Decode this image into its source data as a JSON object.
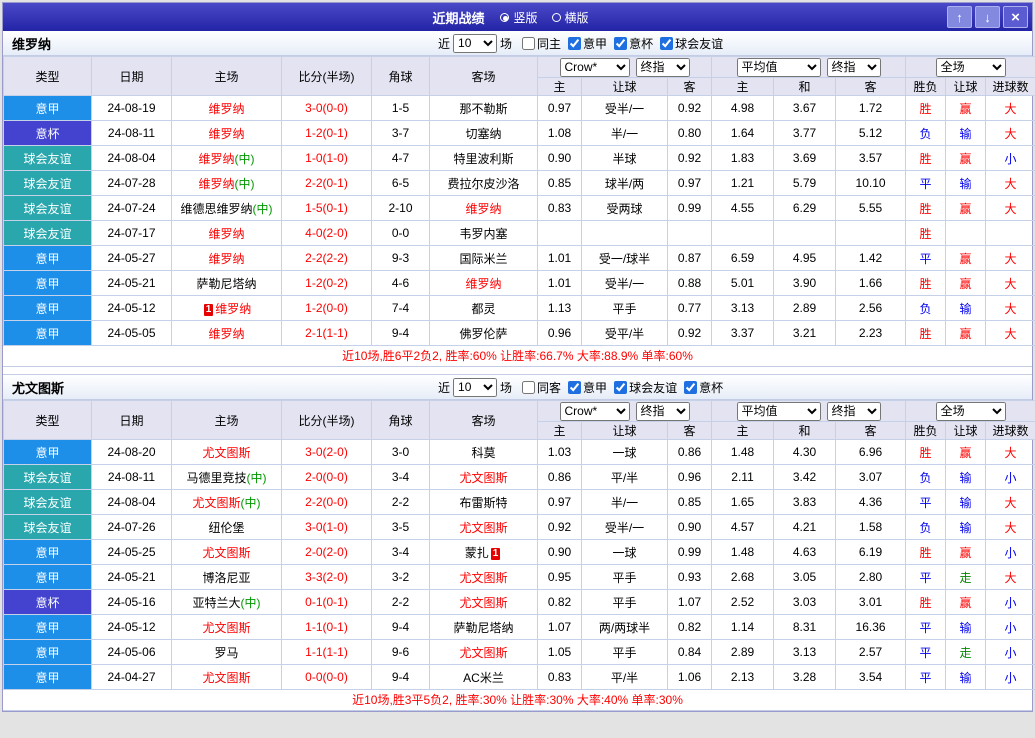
{
  "titlebar": {
    "title": "近期战绩",
    "layout_options": [
      {
        "label": "竖版",
        "selected": true
      },
      {
        "label": "横版",
        "selected": false
      }
    ],
    "up_button": "↑",
    "down_button": "↓",
    "close_button": "×"
  },
  "filter_labels": {
    "near": "近",
    "games": "场"
  },
  "table_header": {
    "left_columns": [
      "类型",
      "日期",
      "主场",
      "比分(半场)",
      "角球",
      "客场"
    ],
    "odds_subcolumns": [
      "主",
      "让球",
      "客"
    ],
    "avg_subcolumns": [
      "主",
      "和",
      "客"
    ],
    "result_subcolumns": [
      "胜负",
      "让球",
      "进球数"
    ],
    "company_select": "Crow*",
    "company_final_select": "终指",
    "avg_select": "平均值",
    "avg_final_select": "终指",
    "scope_select": "全场"
  },
  "league_colors": {
    "意甲": "#1E8FE8",
    "意杯": "#4343CF",
    "球会友谊": "#2AA7AD"
  },
  "result_colors": {
    "胜": "#FF0000",
    "平": "#0000EE",
    "负": "#0000EE",
    "赢": "#FF0000",
    "走": "#008800",
    "输": "#0000EE",
    "大": "#FF0000",
    "小": "#0000EE"
  },
  "sections": [
    {
      "team": "维罗纳",
      "filters": {
        "count": "10",
        "same_side": {
          "label": "同主",
          "checked": false
        },
        "leagues": [
          {
            "label": "意甲",
            "checked": true
          },
          {
            "label": "意杯",
            "checked": true
          },
          {
            "label": "球会友谊",
            "checked": true
          }
        ]
      },
      "rows": [
        {
          "league": "意甲",
          "date": "24-08-19",
          "home": "维罗纳",
          "home_focus": true,
          "home_card": "",
          "score": "3-0(0-0)",
          "corners": "1-5",
          "away": "那不勒斯",
          "away_focus": false,
          "away_card": "",
          "odds": [
            "0.97",
            "受半/一",
            "0.92"
          ],
          "avg": [
            "4.98",
            "3.67",
            "1.72"
          ],
          "results": [
            "胜",
            "赢",
            "大"
          ]
        },
        {
          "league": "意杯",
          "date": "24-08-11",
          "home": "维罗纳",
          "home_focus": true,
          "home_card": "",
          "score": "1-2(0-1)",
          "corners": "3-7",
          "away": "切塞纳",
          "away_focus": false,
          "away_card": "",
          "odds": [
            "1.08",
            "半/一",
            "0.80"
          ],
          "avg": [
            "1.64",
            "3.77",
            "5.12"
          ],
          "results": [
            "负",
            "输",
            "大"
          ]
        },
        {
          "league": "球会友谊",
          "date": "24-08-04",
          "home": "维罗纳(中)",
          "home_focus": true,
          "home_card": "",
          "score": "1-0(1-0)",
          "corners": "4-7",
          "away": "特里波利斯",
          "away_focus": false,
          "away_card": "",
          "odds": [
            "0.90",
            "半球",
            "0.92"
          ],
          "avg": [
            "1.83",
            "3.69",
            "3.57"
          ],
          "results": [
            "胜",
            "赢",
            "小"
          ]
        },
        {
          "league": "球会友谊",
          "date": "24-07-28",
          "home": "维罗纳(中)",
          "home_focus": true,
          "home_card": "",
          "score": "2-2(0-1)",
          "corners": "6-5",
          "away": "费拉尔皮沙洛",
          "away_focus": false,
          "away_card": "",
          "odds": [
            "0.85",
            "球半/两",
            "0.97"
          ],
          "avg": [
            "1.21",
            "5.79",
            "10.10"
          ],
          "results": [
            "平",
            "输",
            "大"
          ]
        },
        {
          "league": "球会友谊",
          "date": "24-07-24",
          "home": "维德思维罗纳(中)",
          "home_focus": false,
          "home_card": "",
          "score": "1-5(0-1)",
          "corners": "2-10",
          "away": "维罗纳",
          "away_focus": true,
          "away_card": "",
          "odds": [
            "0.83",
            "受两球",
            "0.99"
          ],
          "avg": [
            "4.55",
            "6.29",
            "5.55"
          ],
          "results": [
            "胜",
            "赢",
            "大"
          ]
        },
        {
          "league": "球会友谊",
          "date": "24-07-17",
          "home": "维罗纳",
          "home_focus": true,
          "home_card": "",
          "score": "4-0(2-0)",
          "corners": "0-0",
          "away": "韦罗内塞",
          "away_focus": false,
          "away_card": "",
          "odds": [
            "",
            "",
            ""
          ],
          "avg": [
            "",
            "",
            ""
          ],
          "results": [
            "胜",
            "",
            ""
          ]
        },
        {
          "league": "意甲",
          "date": "24-05-27",
          "home": "维罗纳",
          "home_focus": true,
          "home_card": "",
          "score": "2-2(2-2)",
          "corners": "9-3",
          "away": "国际米兰",
          "away_focus": false,
          "away_card": "",
          "odds": [
            "1.01",
            "受一/球半",
            "0.87"
          ],
          "avg": [
            "6.59",
            "4.95",
            "1.42"
          ],
          "results": [
            "平",
            "赢",
            "大"
          ]
        },
        {
          "league": "意甲",
          "date": "24-05-21",
          "home": "萨勒尼塔纳",
          "home_focus": false,
          "home_card": "",
          "score": "1-2(0-2)",
          "corners": "4-6",
          "away": "维罗纳",
          "away_focus": true,
          "away_card": "",
          "odds": [
            "1.01",
            "受半/一",
            "0.88"
          ],
          "avg": [
            "5.01",
            "3.90",
            "1.66"
          ],
          "results": [
            "胜",
            "赢",
            "大"
          ]
        },
        {
          "league": "意甲",
          "date": "24-05-12",
          "home": "维罗纳",
          "home_focus": true,
          "home_card": "1",
          "score": "1-2(0-0)",
          "corners": "7-4",
          "away": "都灵",
          "away_focus": false,
          "away_card": "",
          "odds": [
            "1.13",
            "平手",
            "0.77"
          ],
          "avg": [
            "3.13",
            "2.89",
            "2.56"
          ],
          "results": [
            "负",
            "输",
            "大"
          ]
        },
        {
          "league": "意甲",
          "date": "24-05-05",
          "home": "维罗纳",
          "home_focus": true,
          "home_card": "",
          "score": "2-1(1-1)",
          "corners": "9-4",
          "away": "佛罗伦萨",
          "away_focus": false,
          "away_card": "",
          "odds": [
            "0.96",
            "受平/半",
            "0.92"
          ],
          "avg": [
            "3.37",
            "3.21",
            "2.23"
          ],
          "results": [
            "胜",
            "赢",
            "大"
          ]
        }
      ],
      "summary": "近10场,胜6平2负2, 胜率:60% 让胜率:66.7% 大率:88.9% 单率:60%"
    },
    {
      "team": "尤文图斯",
      "filters": {
        "count": "10",
        "same_side": {
          "label": "同客",
          "checked": false
        },
        "leagues": [
          {
            "label": "意甲",
            "checked": true
          },
          {
            "label": "球会友谊",
            "checked": true
          },
          {
            "label": "意杯",
            "checked": true
          }
        ]
      },
      "rows": [
        {
          "league": "意甲",
          "date": "24-08-20",
          "home": "尤文图斯",
          "home_focus": true,
          "home_card": "",
          "score": "3-0(2-0)",
          "corners": "3-0",
          "away": "科莫",
          "away_focus": false,
          "away_card": "",
          "odds": [
            "1.03",
            "一球",
            "0.86"
          ],
          "avg": [
            "1.48",
            "4.30",
            "6.96"
          ],
          "results": [
            "胜",
            "赢",
            "大"
          ]
        },
        {
          "league": "球会友谊",
          "date": "24-08-11",
          "home": "马德里竞技(中)",
          "home_focus": false,
          "home_card": "",
          "score": "2-0(0-0)",
          "corners": "3-4",
          "away": "尤文图斯",
          "away_focus": true,
          "away_card": "",
          "odds": [
            "0.86",
            "平/半",
            "0.96"
          ],
          "avg": [
            "2.11",
            "3.42",
            "3.07"
          ],
          "results": [
            "负",
            "输",
            "小"
          ]
        },
        {
          "league": "球会友谊",
          "date": "24-08-04",
          "home": "尤文图斯(中)",
          "home_focus": true,
          "home_card": "",
          "score": "2-2(0-0)",
          "corners": "2-2",
          "away": "布雷斯特",
          "away_focus": false,
          "away_card": "",
          "odds": [
            "0.97",
            "半/一",
            "0.85"
          ],
          "avg": [
            "1.65",
            "3.83",
            "4.36"
          ],
          "results": [
            "平",
            "输",
            "大"
          ]
        },
        {
          "league": "球会友谊",
          "date": "24-07-26",
          "home": "纽伦堡",
          "home_focus": false,
          "home_card": "",
          "score": "3-0(1-0)",
          "corners": "3-5",
          "away": "尤文图斯",
          "away_focus": true,
          "away_card": "",
          "odds": [
            "0.92",
            "受半/一",
            "0.90"
          ],
          "avg": [
            "4.57",
            "4.21",
            "1.58"
          ],
          "results": [
            "负",
            "输",
            "大"
          ]
        },
        {
          "league": "意甲",
          "date": "24-05-25",
          "home": "尤文图斯",
          "home_focus": true,
          "home_card": "",
          "score": "2-0(2-0)",
          "corners": "3-4",
          "away": "蒙扎",
          "away_focus": false,
          "away_card": "1",
          "odds": [
            "0.90",
            "一球",
            "0.99"
          ],
          "avg": [
            "1.48",
            "4.63",
            "6.19"
          ],
          "results": [
            "胜",
            "赢",
            "小"
          ]
        },
        {
          "league": "意甲",
          "date": "24-05-21",
          "home": "博洛尼亚",
          "home_focus": false,
          "home_card": "",
          "score": "3-3(2-0)",
          "corners": "3-2",
          "away": "尤文图斯",
          "away_focus": true,
          "away_card": "",
          "odds": [
            "0.95",
            "平手",
            "0.93"
          ],
          "avg": [
            "2.68",
            "3.05",
            "2.80"
          ],
          "results": [
            "平",
            "走",
            "大"
          ]
        },
        {
          "league": "意杯",
          "date": "24-05-16",
          "home": "亚特兰大(中)",
          "home_focus": false,
          "home_card": "",
          "score": "0-1(0-1)",
          "corners": "2-2",
          "away": "尤文图斯",
          "away_focus": true,
          "away_card": "",
          "odds": [
            "0.82",
            "平手",
            "1.07"
          ],
          "avg": [
            "2.52",
            "3.03",
            "3.01"
          ],
          "results": [
            "胜",
            "赢",
            "小"
          ]
        },
        {
          "league": "意甲",
          "date": "24-05-12",
          "home": "尤文图斯",
          "home_focus": true,
          "home_card": "",
          "score": "1-1(0-1)",
          "corners": "9-4",
          "away": "萨勒尼塔纳",
          "away_focus": false,
          "away_card": "",
          "odds": [
            "1.07",
            "两/两球半",
            "0.82"
          ],
          "avg": [
            "1.14",
            "8.31",
            "16.36"
          ],
          "results": [
            "平",
            "输",
            "小"
          ]
        },
        {
          "league": "意甲",
          "date": "24-05-06",
          "home": "罗马",
          "home_focus": false,
          "home_card": "",
          "score": "1-1(1-1)",
          "corners": "9-6",
          "away": "尤文图斯",
          "away_focus": true,
          "away_card": "",
          "odds": [
            "1.05",
            "平手",
            "0.84"
          ],
          "avg": [
            "2.89",
            "3.13",
            "2.57"
          ],
          "results": [
            "平",
            "走",
            "小"
          ]
        },
        {
          "league": "意甲",
          "date": "24-04-27",
          "home": "尤文图斯",
          "home_focus": true,
          "home_card": "",
          "score": "0-0(0-0)",
          "corners": "9-4",
          "away": "AC米兰",
          "away_focus": false,
          "away_card": "",
          "odds": [
            "0.83",
            "平/半",
            "1.06"
          ],
          "avg": [
            "2.13",
            "3.28",
            "3.54"
          ],
          "results": [
            "平",
            "输",
            "小"
          ]
        }
      ],
      "summary": "近10场,胜3平5负2, 胜率:30% 让胜率:30% 大率:40% 单率:30%"
    }
  ]
}
